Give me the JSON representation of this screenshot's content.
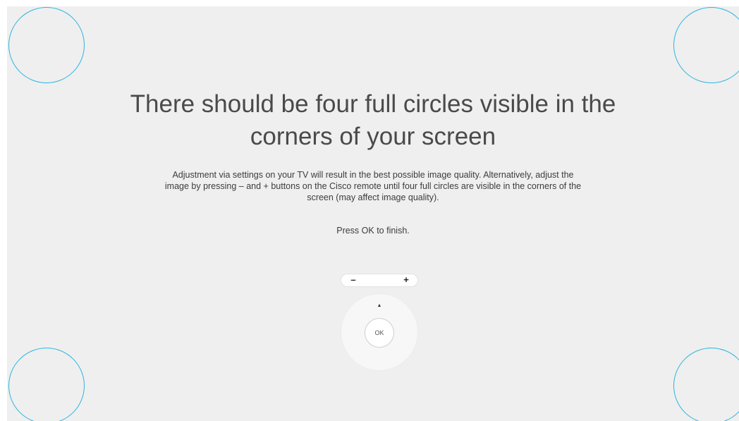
{
  "title": {
    "line1": "There should be four full circles visible in the",
    "line2": "corners of your screen"
  },
  "description": {
    "line1": "Adjustment via settings on your TV will result in the best possible image quality. Alternatively, adjust the",
    "line2": "image by pressing – and + buttons on the Cisco remote until four full circles are visible in the corners of the",
    "line3": "screen (may affect image quality)."
  },
  "instruction": "Press OK to finish.",
  "remote": {
    "minus_label": "–",
    "plus_label": "+",
    "up_arrow": "▲",
    "ok_label": "OK"
  },
  "colors": {
    "background": "#efefef",
    "circle_accent": "#2bb5e0"
  }
}
